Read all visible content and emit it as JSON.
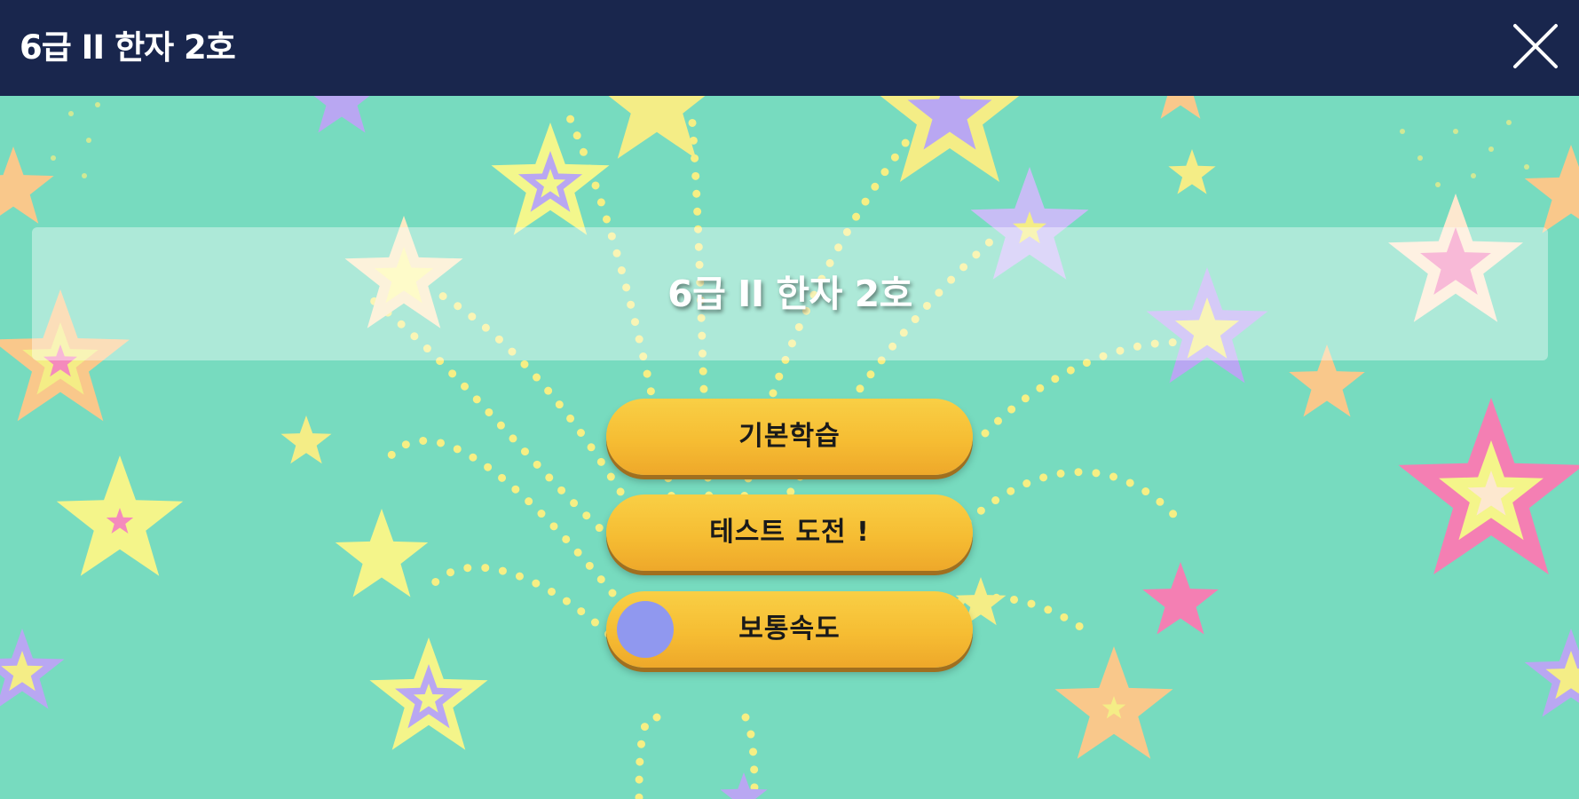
{
  "header": {
    "title": "6급 II 한자 2호",
    "close_icon": "close-icon"
  },
  "banner": {
    "title": "6급 II 한자 2호"
  },
  "menu": {
    "basic_label": "기본학습",
    "test_label": "테스트 도전 !",
    "speed_label": "보통속도"
  },
  "colors": {
    "header_bg": "#19264d",
    "stage_bg": "#77dbbf",
    "button": "#f6bd33",
    "toggle_dot": "#9098ef"
  }
}
